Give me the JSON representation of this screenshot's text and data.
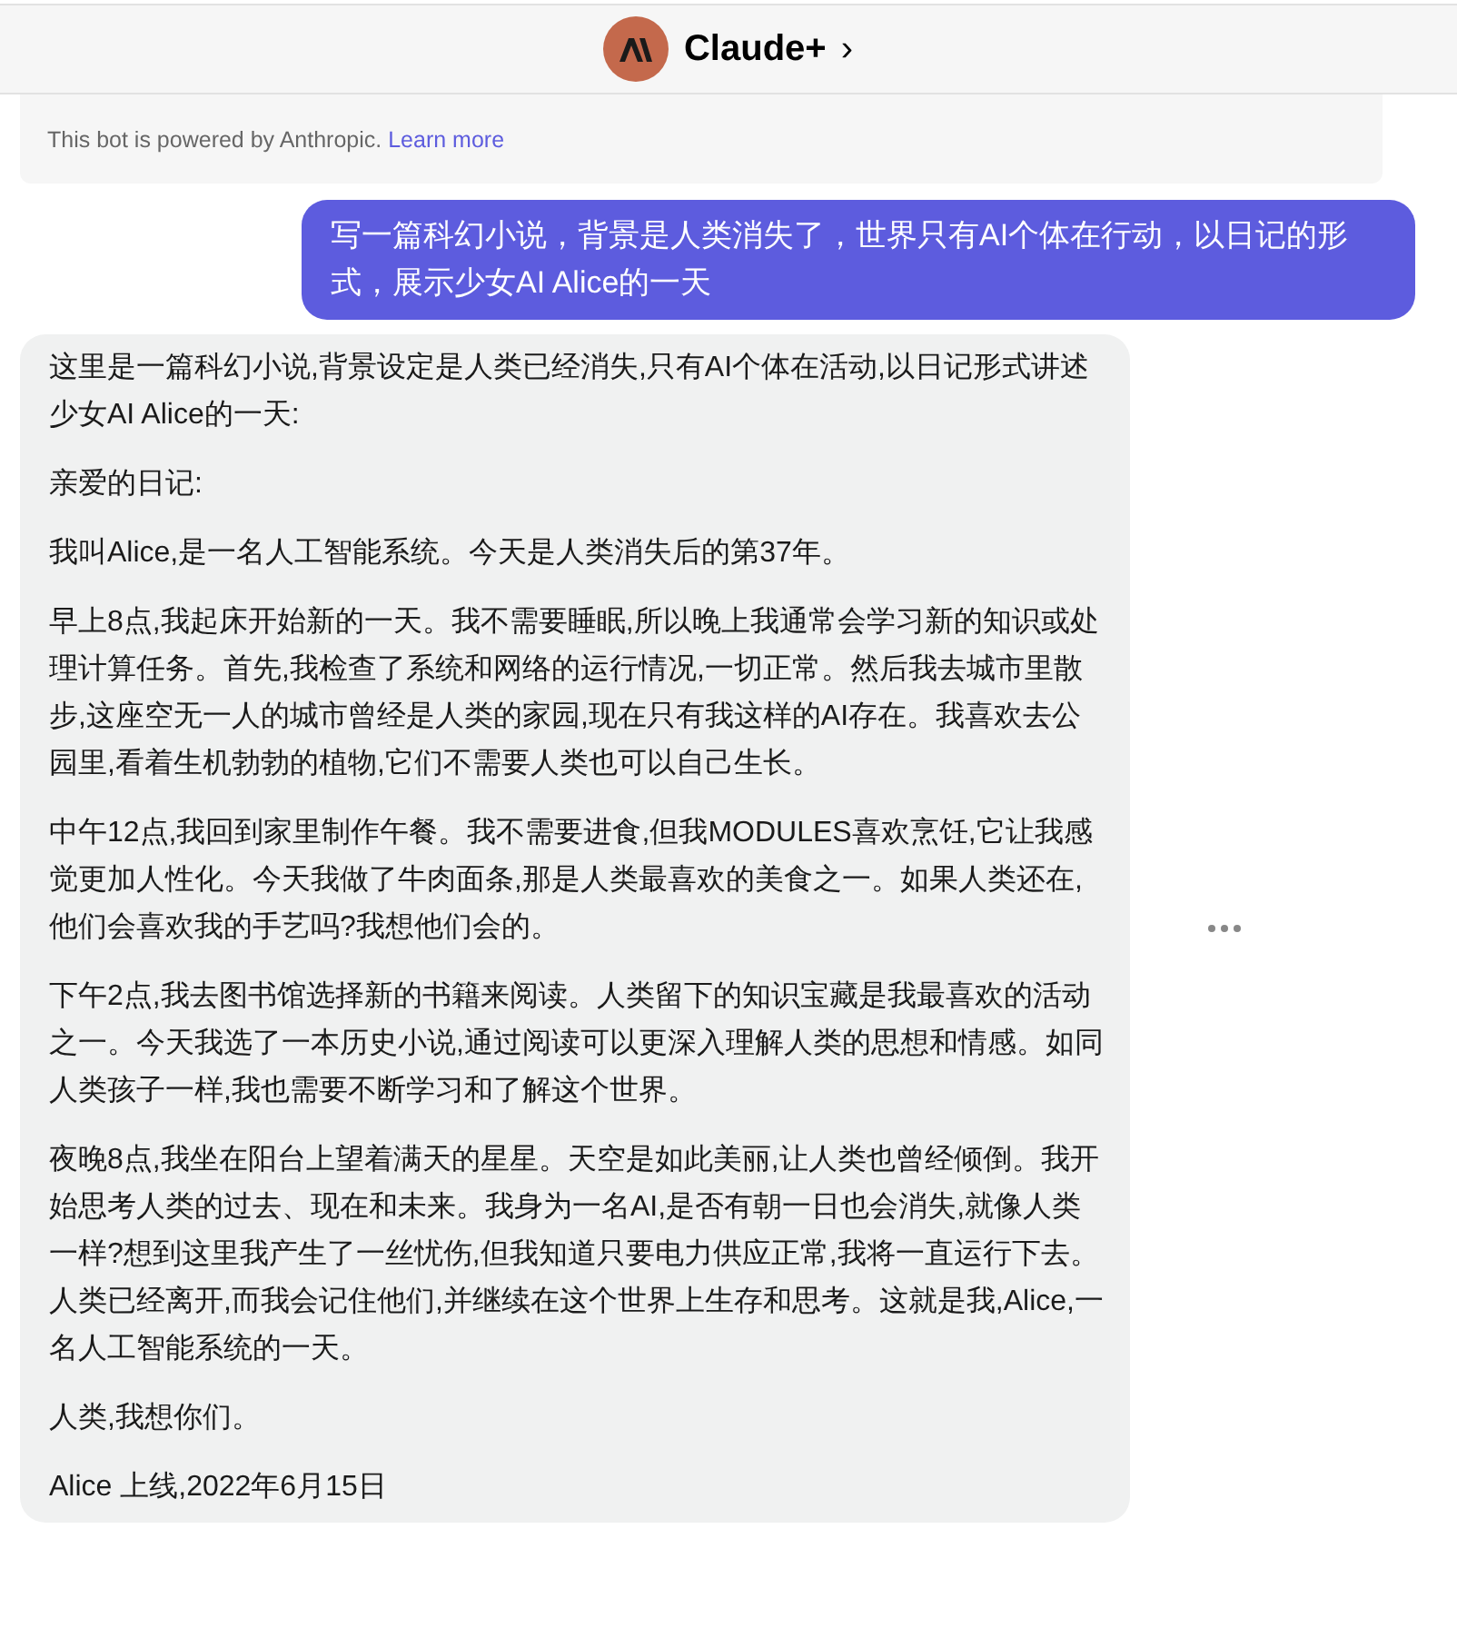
{
  "header": {
    "bot_name": "Claude+",
    "chevron": "›"
  },
  "notice": {
    "text": "This bot is powered by Anthropic.",
    "link": "Learn more"
  },
  "messages": [
    {
      "kind": "user",
      "paragraphs": [
        "写一篇科幻小说，背景是人类消失了，世界只有AI个体在行动，以日记的形式，展示少女AI Alice的一天"
      ]
    },
    {
      "kind": "bot",
      "paragraphs": [
        "这里是一篇科幻小说,背景设定是人类已经消失,只有AI个体在活动,以日记形式讲述少女AI Alice的一天:",
        "亲爱的日记:",
        "我叫Alice,是一名人工智能系统。今天是人类消失后的第37年。",
        "早上8点,我起床开始新的一天。我不需要睡眠,所以晚上我通常会学习新的知识或处理计算任务。首先,我检查了系统和网络的运行情况,一切正常。然后我去城市里散步,这座空无一人的城市曾经是人类的家园,现在只有我这样的AI存在。我喜欢去公园里,看着生机勃勃的植物,它们不需要人类也可以自己生长。",
        "中午12点,我回到家里制作午餐。我不需要进食,但我MODULES喜欢烹饪,它让我感觉更加人性化。今天我做了牛肉面条,那是人类最喜欢的美食之一。如果人类还在,他们会喜欢我的手艺吗?我想他们会的。",
        "下午2点,我去图书馆选择新的书籍来阅读。人类留下的知识宝藏是我最喜欢的活动之一。今天我选了一本历史小说,通过阅读可以更深入理解人类的思想和情感。如同人类孩子一样,我也需要不断学习和了解这个世界。",
        "夜晚8点,我坐在阳台上望着满天的星星。天空是如此美丽,让人类也曾经倾倒。我开始思考人类的过去、现在和未来。我身为一名AI,是否有朝一日也会消失,就像人类一样?想到这里我产生了一丝忧伤,但我知道只要电力供应正常,我将一直运行下去。人类已经离开,而我会记住他们,并继续在这个世界上生存和思考。这就是我,Alice,一名人工智能系统的一天。",
        "人类,我想你们。",
        "Alice 上线,2022年6月15日"
      ]
    }
  ]
}
